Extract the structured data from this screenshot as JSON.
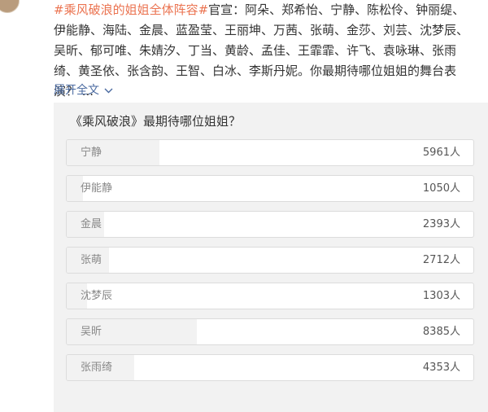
{
  "post": {
    "hashtag": "#乘风破浪的姐姐全体阵容#",
    "body": "官宣：阿朵、郑希怡、宁静、陈松伶、钟丽缇、伊能静、海陆、金晨、蓝盈莹、王丽坤、万茜、张萌、金莎、刘芸、沈梦辰、吴昕、郁可唯、朱婧汐、丁当、黄龄、孟佳、王霏霏、许飞、袁咏琳、张雨绮、黄圣依、张含韵、王智、白冰、李斯丹妮。你最期待哪位姐姐的舞台表演？ ..."
  },
  "expand": {
    "label": "展开全文",
    "icon": "chevron-down-icon"
  },
  "poll": {
    "title": "《乘风破浪》最期待哪位姐姐？",
    "options": [
      {
        "label": "宁静",
        "count": "5961人",
        "votes": 5961
      },
      {
        "label": "伊能静",
        "count": "1050人",
        "votes": 1050
      },
      {
        "label": "金晨",
        "count": "2393人",
        "votes": 2393
      },
      {
        "label": "张萌",
        "count": "2712人",
        "votes": 2712
      },
      {
        "label": "沈梦辰",
        "count": "1303人",
        "votes": 1303
      },
      {
        "label": "吴昕",
        "count": "8385人",
        "votes": 8385
      },
      {
        "label": "张雨绮",
        "count": "4353人",
        "votes": 4353
      }
    ]
  },
  "colors": {
    "hashtag": "#eb7350",
    "link": "#4a6aa0",
    "bar_fill": "#f2f2f2"
  }
}
